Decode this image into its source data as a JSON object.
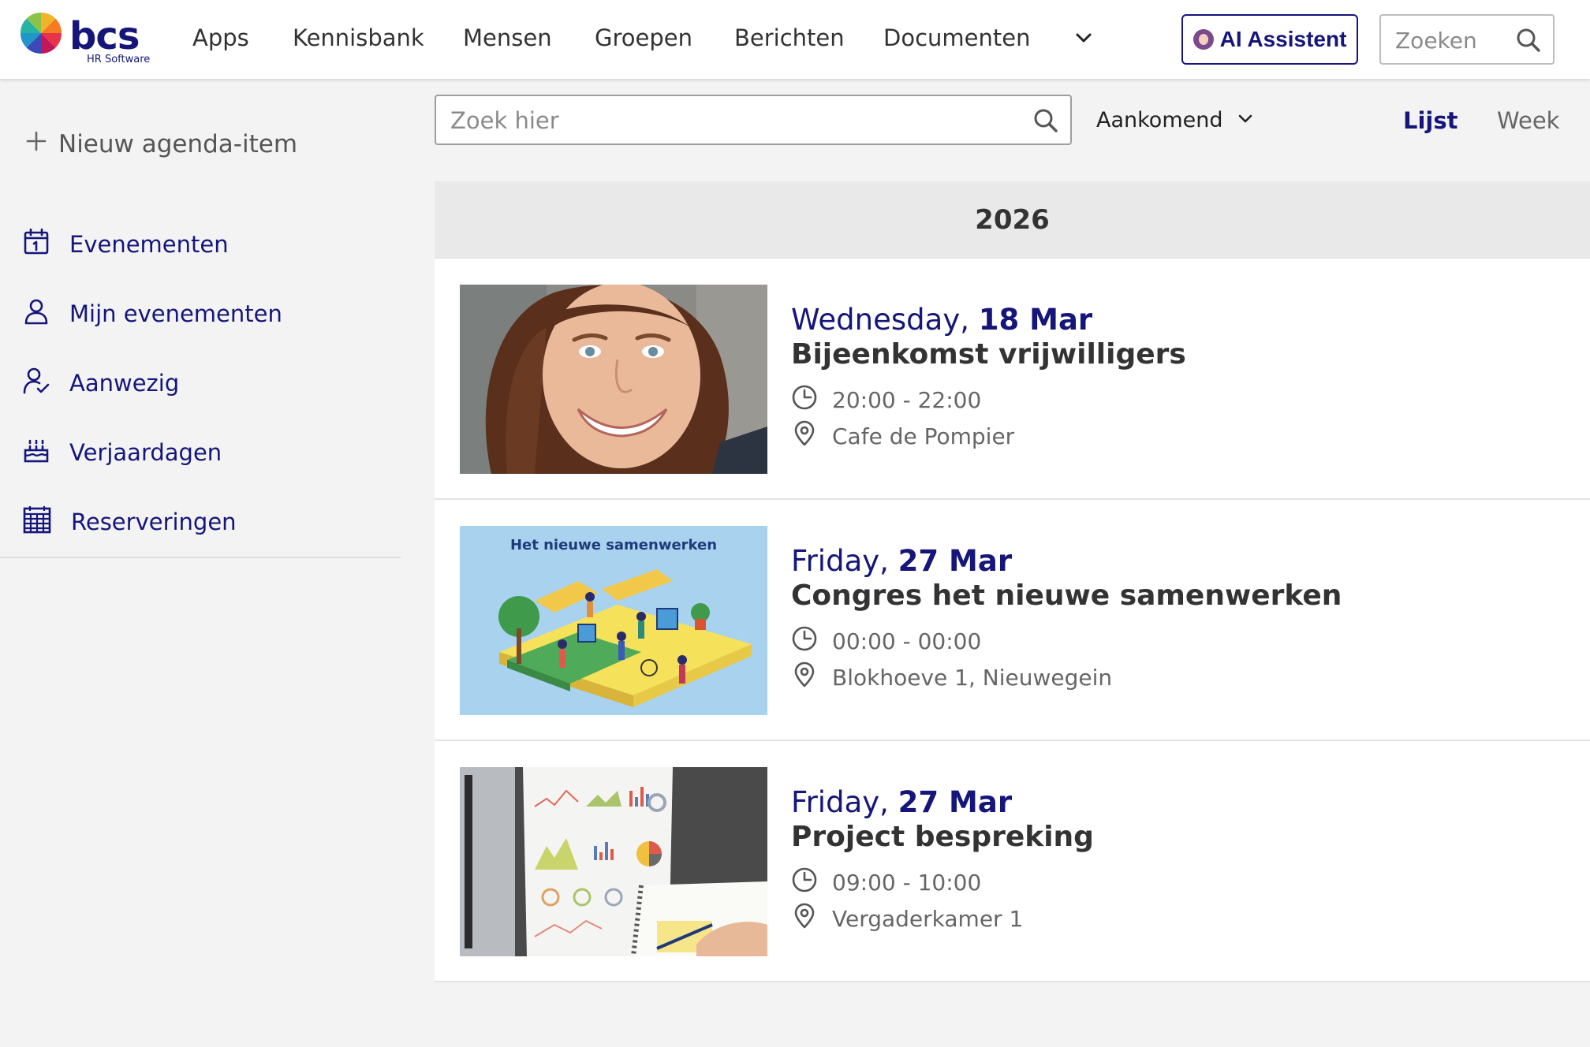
{
  "brand": {
    "name": "bcs",
    "tagline": "HR Software"
  },
  "nav": {
    "items": [
      "Apps",
      "Kennisbank",
      "Mensen",
      "Groepen",
      "Berichten",
      "Documenten"
    ],
    "more_icon": "chevron-down-icon",
    "ai_button": "AI Assistent",
    "search_placeholder": "Zoeken"
  },
  "sidebar": {
    "new_item": "Nieuw agenda-item",
    "items": [
      {
        "label": "Evenementen",
        "icon": "calendar-day-icon"
      },
      {
        "label": "Mijn evenementen",
        "icon": "user-icon"
      },
      {
        "label": "Aanwezig",
        "icon": "user-check-icon"
      },
      {
        "label": "Verjaardagen",
        "icon": "birthday-cake-icon"
      },
      {
        "label": "Reserveringen",
        "icon": "calendar-grid-icon"
      }
    ]
  },
  "toolbar": {
    "search_placeholder": "Zoek hier",
    "filter": "Aankomend",
    "views": [
      {
        "label": "Lijst",
        "active": true
      },
      {
        "label": "Week",
        "active": false
      }
    ]
  },
  "agenda": {
    "year": "2026",
    "events": [
      {
        "weekday": "Wednesday,",
        "date": "18 Mar",
        "title": "Bijeenkomst vrijwilligers",
        "time": "20:00 - 22:00",
        "location": "Cafe de Pompier",
        "image": "portrait-photo"
      },
      {
        "weekday": "Friday,",
        "date": "27 Mar",
        "title": "Congres het nieuwe samenwerken",
        "time": "00:00 - 00:00",
        "location": "Blokhoeve 1, Nieuwegein",
        "image": "illustration",
        "image_caption": "Het nieuwe samenwerken"
      },
      {
        "weekday": "Friday,",
        "date": "27 Mar",
        "title": "Project bespreking",
        "time": "09:00 - 10:00",
        "location": "Vergaderkamer 1",
        "image": "charts-photo"
      }
    ]
  },
  "colors": {
    "brand_navy": "#15157a",
    "background": "#f3f3f3"
  }
}
